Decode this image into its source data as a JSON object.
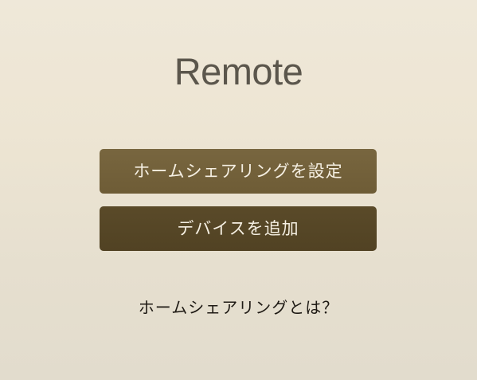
{
  "app": {
    "title": "Remote"
  },
  "buttons": {
    "setup_home_sharing": "ホームシェアリングを設定",
    "add_device": "デバイスを追加"
  },
  "links": {
    "what_is_home_sharing": "ホームシェアリングとは？"
  },
  "colors": {
    "background": "#ede5d3",
    "primary_button": "#74623b",
    "secondary_button": "#564727",
    "button_text": "#f5efe2",
    "title_text": "#5b564c",
    "link_text": "#1e1a14"
  }
}
